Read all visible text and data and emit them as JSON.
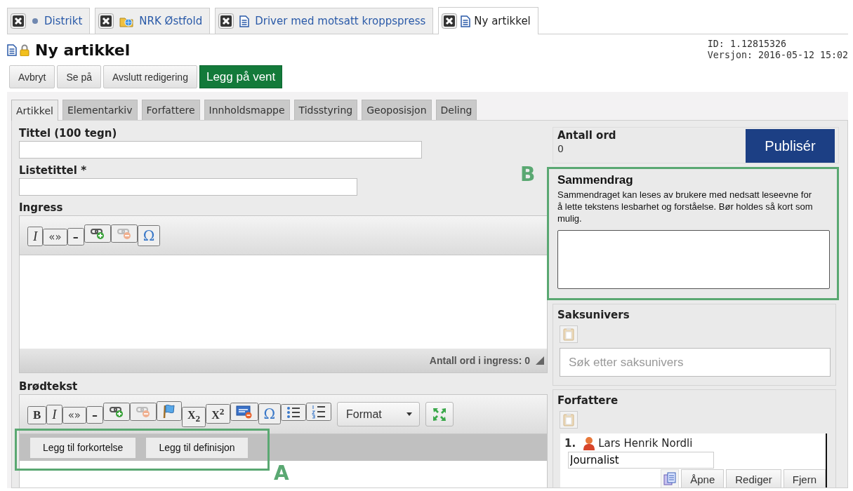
{
  "document_tabs": [
    {
      "label": "Distrikt",
      "selected": false
    },
    {
      "label": "NRK Østfold",
      "selected": false
    },
    {
      "label": "Driver med motsatt kroppspress",
      "selected": false
    },
    {
      "label": "Ny artikkel",
      "selected": true
    }
  ],
  "page": {
    "title": "Ny artikkel",
    "id": "ID: 1.12815326",
    "version": "Versjon: 2016-05-12 15:02"
  },
  "actions": [
    {
      "label": "Avbryt",
      "primary": false
    },
    {
      "label": "Se på",
      "primary": false
    },
    {
      "label": "Avslutt redigering",
      "primary": false
    },
    {
      "label": "Legg på vent",
      "primary": true
    }
  ],
  "editor_tabs": [
    {
      "label": "Artikkel",
      "selected": true
    },
    {
      "label": "Elementarkiv",
      "selected": false
    },
    {
      "label": "Forfattere",
      "selected": false
    },
    {
      "label": "Innholdsmappe",
      "selected": false
    },
    {
      "label": "Tidsstyring",
      "selected": false
    },
    {
      "label": "Geoposisjon",
      "selected": false
    },
    {
      "label": "Deling",
      "selected": false
    }
  ],
  "fields": [
    {
      "label": "Tittel (100 tegn)"
    },
    {
      "label": "Listetittel *"
    }
  ],
  "ingress": {
    "label": "Ingress",
    "word_count": "Antall ord i ingress: 0",
    "toolbar": [
      {
        "kind": "italic",
        "text": "I"
      },
      {
        "kind": "quote",
        "text": "«»"
      },
      {
        "kind": "dash",
        "text": "–"
      },
      {
        "kind": "separator"
      },
      {
        "kind": "link"
      },
      {
        "kind": "unlink"
      },
      {
        "kind": "separator"
      },
      {
        "kind": "special",
        "text": "Ω"
      }
    ]
  },
  "body": {
    "label": "Brødtekst",
    "format": "Format",
    "toolbar": [
      {
        "kind": "bold",
        "text": "B"
      },
      {
        "kind": "separator"
      },
      {
        "kind": "italic",
        "text": "I"
      },
      {
        "kind": "quote",
        "text": "«»"
      },
      {
        "kind": "dash",
        "text": "–"
      },
      {
        "kind": "separator"
      },
      {
        "kind": "link"
      },
      {
        "kind": "unlink"
      },
      {
        "kind": "flag"
      },
      {
        "kind": "separator"
      },
      {
        "kind": "subscript",
        "text": "X$_{2}$"
      },
      {
        "kind": "superscript",
        "text": "X$^{2}$"
      },
      {
        "kind": "separator"
      },
      {
        "kind": "html"
      },
      {
        "kind": "separator"
      },
      {
        "kind": "special",
        "text": "Ω"
      },
      {
        "kind": "bullets"
      },
      {
        "kind": "separator"
      },
      {
        "kind": "numbers"
      }
    ],
    "extra_buttons": [
      "Legg til forkortelse",
      "Legg til definisjon"
    ]
  },
  "word_count": {
    "label": "Antall ord",
    "value": "0"
  },
  "publish_button": "Publisér",
  "summary": {
    "title": "Sammendrag",
    "description": "Sammendraget kan leses av brukere med nedsatt leseevne for å lette tekstens lesbarhet og forståelse. Bør holdes så kort som mulig."
  },
  "saksunivers": {
    "title": "Saksunivers",
    "placeholder": "Søk etter saksunivers"
  },
  "authors": {
    "title": "Forfattere",
    "items": [
      {
        "number": "1.",
        "name": "Lars Henrik Nordli",
        "role": "Journalist",
        "buttons": [
          "Åpne",
          "Rediger",
          "Fjern"
        ]
      }
    ]
  },
  "annotations": [
    {
      "label": "A"
    },
    {
      "label": "B"
    }
  ]
}
